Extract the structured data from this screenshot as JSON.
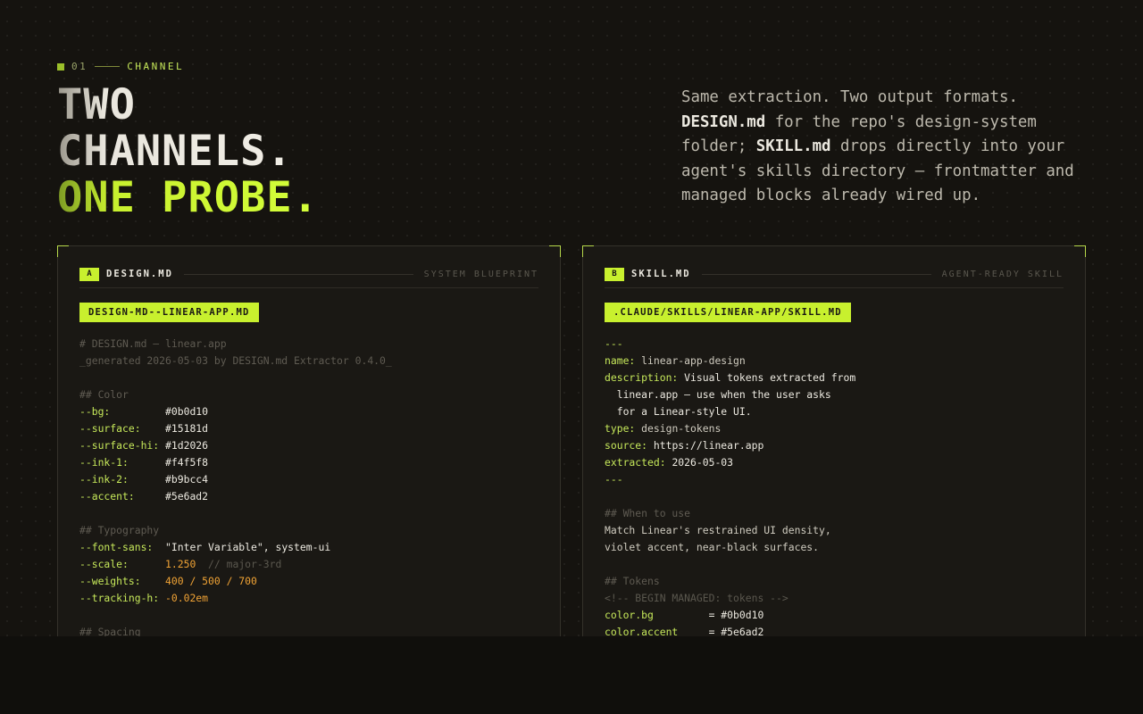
{
  "eyebrow": {
    "number": "01",
    "label": "CHANNEL"
  },
  "headline": {
    "line1": "TWO",
    "line2": "CHANNELS.",
    "line3": "ONE PROBE."
  },
  "intro": {
    "p1": "Same extraction. Two output formats.",
    "b1": "DESIGN.md",
    "p2": " for the repo's design-system folder; ",
    "b2": "SKILL.md",
    "p3": " drops directly into your agent's skills directory — frontmatter and managed blocks already wired up."
  },
  "colors": {
    "accent": "#c8f02e",
    "background": "#15130f",
    "panel": "#1a1814",
    "number": "#f0a335"
  },
  "panels": {
    "a": {
      "tag": "A",
      "title": "DESIGN.MD",
      "subtitle": "SYSTEM BLUEPRINT",
      "file": "DESIGN-MD--LINEAR-APP.MD",
      "lines": [
        {
          "k": "",
          "v": "# DESIGN.md — linear.app",
          "kc": "",
          "vc": "c-com",
          "n": "",
          "cm": ""
        },
        {
          "k": "",
          "v": "_generated 2026-05-03 by DESIGN.md Extractor 0.4.0_",
          "kc": "",
          "vc": "c-com",
          "n": "",
          "cm": ""
        },
        {
          "k": "",
          "v": "",
          "kc": "",
          "vc": "",
          "n": "",
          "cm": ""
        },
        {
          "k": "",
          "v": "## Color",
          "kc": "",
          "vc": "c-com",
          "n": "",
          "cm": ""
        },
        {
          "k": "--bg:         ",
          "v": "#0b0d10",
          "kc": "c-key",
          "vc": "c-val",
          "n": "",
          "cm": ""
        },
        {
          "k": "--surface:    ",
          "v": "#15181d",
          "kc": "c-key",
          "vc": "c-val",
          "n": "",
          "cm": ""
        },
        {
          "k": "--surface-hi: ",
          "v": "#1d2026",
          "kc": "c-key",
          "vc": "c-val",
          "n": "",
          "cm": ""
        },
        {
          "k": "--ink-1:      ",
          "v": "#f4f5f8",
          "kc": "c-key",
          "vc": "c-val",
          "n": "",
          "cm": ""
        },
        {
          "k": "--ink-2:      ",
          "v": "#b9bcc4",
          "kc": "c-key",
          "vc": "c-val",
          "n": "",
          "cm": ""
        },
        {
          "k": "--accent:     ",
          "v": "#5e6ad2",
          "kc": "c-key",
          "vc": "c-val",
          "n": "",
          "cm": ""
        },
        {
          "k": "",
          "v": "",
          "kc": "",
          "vc": "",
          "n": "",
          "cm": ""
        },
        {
          "k": "",
          "v": "## Typography",
          "kc": "",
          "vc": "c-com",
          "n": "",
          "cm": ""
        },
        {
          "k": "--font-sans:  ",
          "v": "\"Inter Variable\", system-ui",
          "kc": "c-key",
          "vc": "c-val",
          "n": "",
          "cm": ""
        },
        {
          "k": "--scale:      ",
          "v": "",
          "kc": "c-key",
          "vc": "",
          "n": "1.250",
          "cm": "  // major-3rd"
        },
        {
          "k": "--weights:    ",
          "v": "",
          "kc": "c-key",
          "vc": "",
          "n": "400 / 500 / 700",
          "cm": ""
        },
        {
          "k": "--tracking-h: ",
          "v": "",
          "kc": "c-key",
          "vc": "",
          "n": "-0.02em",
          "cm": ""
        },
        {
          "k": "",
          "v": "",
          "kc": "",
          "vc": "",
          "n": "",
          "cm": ""
        },
        {
          "k": "",
          "v": "## Spacing",
          "kc": "",
          "vc": "c-com",
          "n": "",
          "cm": ""
        }
      ]
    },
    "b": {
      "tag": "B",
      "title": "SKILL.MD",
      "subtitle": "AGENT-READY SKILL",
      "file": ".CLAUDE/SKILLS/LINEAR-APP/SKILL.MD",
      "lines": [
        {
          "k": "---",
          "v": "",
          "kc": "c-key",
          "vc": "",
          "n": "",
          "cm": ""
        },
        {
          "k": "name: ",
          "v": "linear-app-design",
          "kc": "c-key",
          "vc": "c-txt",
          "n": "",
          "cm": ""
        },
        {
          "k": "description: ",
          "v": "Visual tokens extracted from",
          "kc": "c-key",
          "vc": "c-val",
          "n": "",
          "cm": ""
        },
        {
          "k": "",
          "v": "  linear.app — use when the user asks",
          "kc": "",
          "vc": "c-val",
          "n": "",
          "cm": ""
        },
        {
          "k": "",
          "v": "  for a Linear-style UI.",
          "kc": "",
          "vc": "c-val",
          "n": "",
          "cm": ""
        },
        {
          "k": "type: ",
          "v": "design-tokens",
          "kc": "c-key",
          "vc": "c-txt",
          "n": "",
          "cm": ""
        },
        {
          "k": "source: ",
          "v": "https://linear.app",
          "kc": "c-key",
          "vc": "c-val",
          "n": "",
          "cm": ""
        },
        {
          "k": "extracted: ",
          "v": "2026-05-03",
          "kc": "c-key",
          "vc": "c-val",
          "n": "",
          "cm": ""
        },
        {
          "k": "---",
          "v": "",
          "kc": "c-key",
          "vc": "",
          "n": "",
          "cm": ""
        },
        {
          "k": "",
          "v": "",
          "kc": "",
          "vc": "",
          "n": "",
          "cm": ""
        },
        {
          "k": "",
          "v": "## When to use",
          "kc": "",
          "vc": "c-com",
          "n": "",
          "cm": ""
        },
        {
          "k": "",
          "v": "Match Linear's restrained UI density,",
          "kc": "",
          "vc": "c-txt",
          "n": "",
          "cm": ""
        },
        {
          "k": "",
          "v": "violet accent, near-black surfaces.",
          "kc": "",
          "vc": "c-txt",
          "n": "",
          "cm": ""
        },
        {
          "k": "",
          "v": "",
          "kc": "",
          "vc": "",
          "n": "",
          "cm": ""
        },
        {
          "k": "",
          "v": "## Tokens",
          "kc": "",
          "vc": "c-com",
          "n": "",
          "cm": ""
        },
        {
          "k": "",
          "v": "<!-- BEGIN MANAGED: tokens -->",
          "kc": "",
          "vc": "c-dim",
          "n": "",
          "cm": ""
        },
        {
          "k": "color.bg         ",
          "v": "= #0b0d10",
          "kc": "c-key",
          "vc": "c-val",
          "n": "",
          "cm": ""
        },
        {
          "k": "color.accent     ",
          "v": "= #5e6ad2",
          "kc": "c-key",
          "vc": "c-val",
          "n": "",
          "cm": ""
        }
      ]
    }
  }
}
